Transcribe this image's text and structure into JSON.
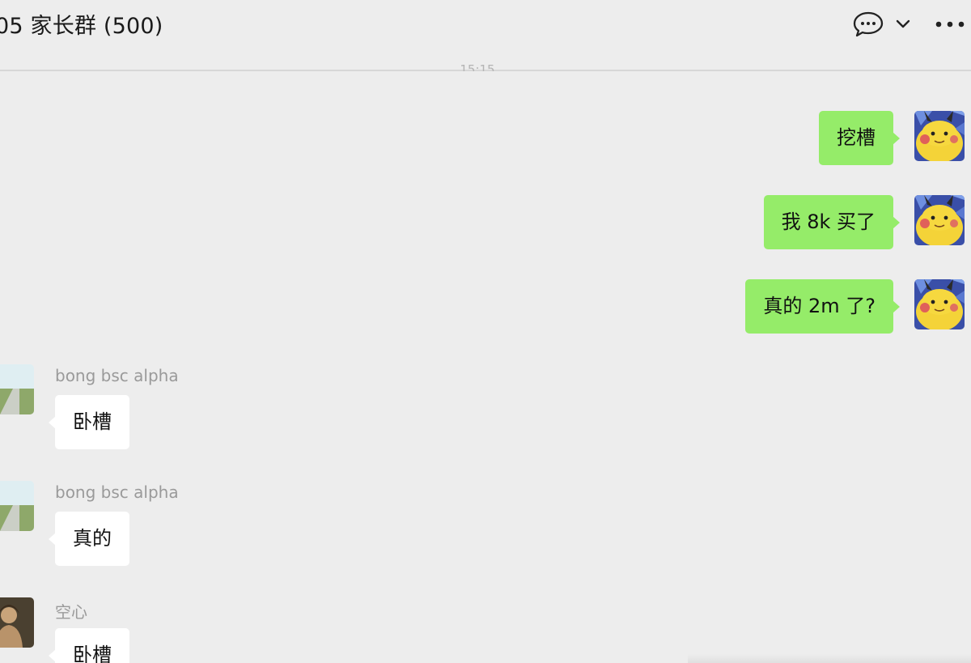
{
  "header": {
    "title": "05 家长群 (500)",
    "icons": [
      "chat-bubble-icon",
      "chevron-down-icon",
      "more-icon"
    ]
  },
  "timestamp": "15:15",
  "messages": [
    {
      "direction": "out",
      "text": "挖槽"
    },
    {
      "direction": "out",
      "text": "我 8k 买了"
    },
    {
      "direction": "out",
      "text": "真的 2m 了?"
    },
    {
      "direction": "in",
      "sender": "bong bsc alpha",
      "text": "卧槽"
    },
    {
      "direction": "in",
      "sender": "bong bsc alpha",
      "text": "真的"
    },
    {
      "direction": "in",
      "sender": "空心",
      "text": "卧槽"
    }
  ],
  "colors": {
    "background": "#ededed",
    "outgoing_bubble": "#95ec69",
    "incoming_bubble": "#ffffff",
    "sender_name": "#9a9a9a"
  }
}
